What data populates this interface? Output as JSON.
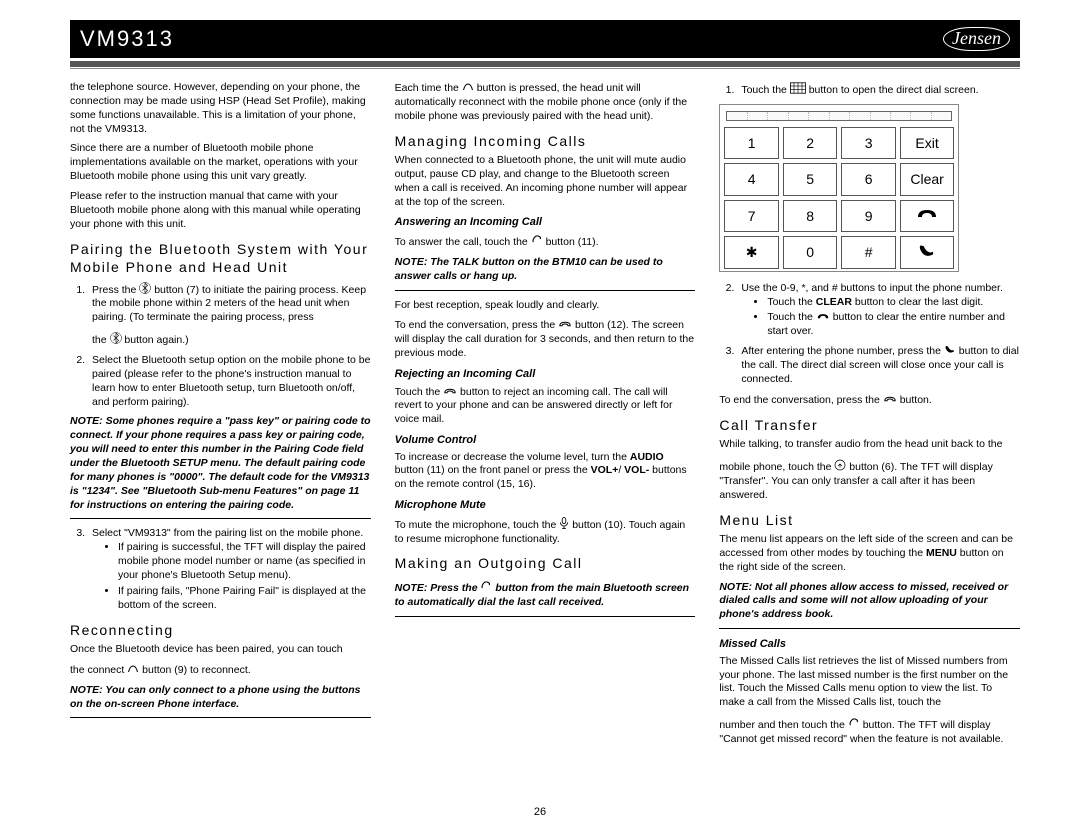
{
  "header": {
    "model": "VM9313",
    "brand": "Jensen"
  },
  "col1": {
    "p1": "the telephone source. However, depending on your phone, the connection may be made using HSP (Head Set Profile), making some functions unavailable. This is a limitation of your phone, not the VM9313.",
    "p2": "Since there are a number of Bluetooth mobile phone implementations available on the market, operations with your Bluetooth mobile phone using this unit vary greatly.",
    "p3": "Please refer to the instruction manual that came with your Bluetooth mobile phone along with this manual while operating your phone with this unit.",
    "h_pairing": "Pairing the Bluetooth System with Your Mobile Phone and Head Unit",
    "li1a": "Press the ",
    "li1b": " button (7) to initiate the pairing process. Keep the mobile phone within 2 meters of the head unit when pairing. (To terminate the pairing process, press",
    "li1c": "the ",
    "li1d": " button again.)",
    "li2": "Select the Bluetooth setup option on the mobile phone to be paired (please refer to the phone's instruction manual to learn how to enter Bluetooth setup, turn Bluetooth on/off, and perform pairing).",
    "note1": "NOTE: Some phones require a \"pass key\" or pairing code to connect. If your phone requires a pass key or pairing code, you will need to enter this number in the Pairing Code field under the Bluetooth SETUP menu. The default pairing code for many phones is \"0000\". The default code for the VM9313 is \"1234\". See \"Bluetooth Sub-menu Features\" on page 11 for instructions on entering the pairing code.",
    "li3": "Select \"VM9313\" from the pairing list on the mobile phone.",
    "li3a": "If pairing is successful, the TFT will display the paired mobile phone model number or name (as specified in your phone's Bluetooth Setup menu).",
    "li3b": "If pairing fails, \"Phone Pairing Fail\" is displayed at the bottom of the screen.",
    "h_reconnect": "Reconnecting",
    "recon1a": "Once the Bluetooth device has been paired, you can touch",
    "recon1b": "the connect ",
    "recon1c": " button (9) to reconnect.",
    "note2": "NOTE: You can only connect to a phone using the buttons on the on-screen Phone interface."
  },
  "col2": {
    "p1a": "Each time the ",
    "p1b": " button is pressed, the head unit will automatically reconnect with the mobile phone once (only if the mobile phone was previously paired with the head unit).",
    "h_manage": "Managing Incoming Calls",
    "p2": "When connected to a Bluetooth phone, the unit will mute audio output, pause CD play, and change to the Bluetooth screen when a call is received. An incoming phone number will appear at the top of the screen.",
    "h_answer": "Answering an Incoming Call",
    "ans1a": "To answer the call, touch the ",
    "ans1b": " button (11).",
    "note1": "NOTE: The TALK button on the BTM10 can be used to answer calls or hang up.",
    "p3": "For best reception, speak loudly and clearly.",
    "p4a": "To end the conversation, press the ",
    "p4b": " button (12). The screen will display the call duration for 3 seconds, and then return to the previous mode.",
    "h_reject": "Rejecting an Incoming Call",
    "rej1a": "Touch the ",
    "rej1b": " button to reject an incoming call. The call will revert to your phone and can be answered directly or left for voice mail.",
    "h_vol": "Volume Control",
    "vol1a": "To increase or decrease the volume level, turn the ",
    "vol1b": "AUDIO",
    "vol1c": " button (11) on the front panel or press the ",
    "vol1d": "VOL+",
    "vol1e": "/ ",
    "vol1f": "VOL-",
    "vol1g": " buttons on the remote control (15, 16).",
    "h_mic": "Microphone Mute",
    "mic1a": "To mute the microphone, touch the ",
    "mic1b": " button (10). Touch again to resume microphone functionality.",
    "h_out": "Making an Outgoing Call",
    "note2a": "NOTE: Press the ",
    "note2b": " button from the main Bluetooth screen to automatically dial the last call received."
  },
  "col3": {
    "li1a": "Touch the ",
    "li1b": " button to open the direct dial screen.",
    "keypad": {
      "k1": "1",
      "k2": "2",
      "k3": "3",
      "kExit": "Exit",
      "k4": "4",
      "k5": "5",
      "k6": "6",
      "kClear": "Clear",
      "k7": "7",
      "k8": "8",
      "k9": "9",
      "kStar": "✱",
      "k0": "0",
      "kHash": "#"
    },
    "li2": "Use the 0-9, *, and # buttons to input the phone number.",
    "li2a_pre": "Touch the ",
    "li2a_b": "CLEAR",
    "li2a_post": " button to clear the last digit.",
    "li2b_pre": "Touch the ",
    "li2b_post": " button to clear the entire number and start over.",
    "li3a": "After entering the phone number, press the ",
    "li3b": " button to dial the call. The direct dial screen will close once your call is connected.",
    "p_end_a": "To end the conversation, press the ",
    "p_end_b": " button.",
    "h_transfer": "Call Transfer",
    "tr1": "While talking, to transfer audio from the head unit back to the",
    "tr2a": "mobile phone, touch the ",
    "tr2b": " button (6). The TFT will display \"Transfer\". You can only transfer a call after it has been answered.",
    "h_menu": "Menu List",
    "menu1a": "The menu list appears on the left side of the screen and can be accessed from other modes by touching the ",
    "menu1b": "MENU",
    "menu1c": " button on the right side of the screen.",
    "note1": "NOTE: Not all phones allow access to missed, received or dialed calls and some will not allow uploading of your phone's address book.",
    "h_missed": "Missed Calls",
    "miss1": "The Missed Calls list retrieves the list of Missed numbers from your phone. The last missed number is the first number on the list. Touch the Missed Calls menu option to view the list. To make a call from the Missed Calls list, touch the",
    "miss2a": "number and then touch the ",
    "miss2b": " button. The TFT will display \"Cannot get missed record\" when the feature is not available."
  },
  "pagenum": "26"
}
